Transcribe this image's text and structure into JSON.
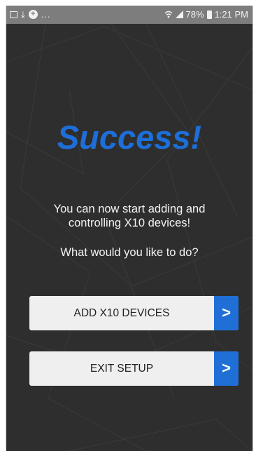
{
  "status_bar": {
    "left_icons": [
      "gallery-icon",
      "download-icon",
      "add-circle-icon"
    ],
    "ellipsis": "...",
    "battery": "78%",
    "time": "1:21 PM"
  },
  "content": {
    "title": "Success!",
    "message": "You can now start adding and controlling X10 devices!",
    "question": "What would you like to do?"
  },
  "buttons": [
    {
      "label": "ADD X10 DEVICES",
      "arrow": ">"
    },
    {
      "label": "EXIT SETUP",
      "arrow": ">"
    }
  ],
  "colors": {
    "accent": "#1f6fd6",
    "background": "#2e2e2e",
    "status_bar": "#7d7d7d",
    "button_bg": "#efefef"
  }
}
